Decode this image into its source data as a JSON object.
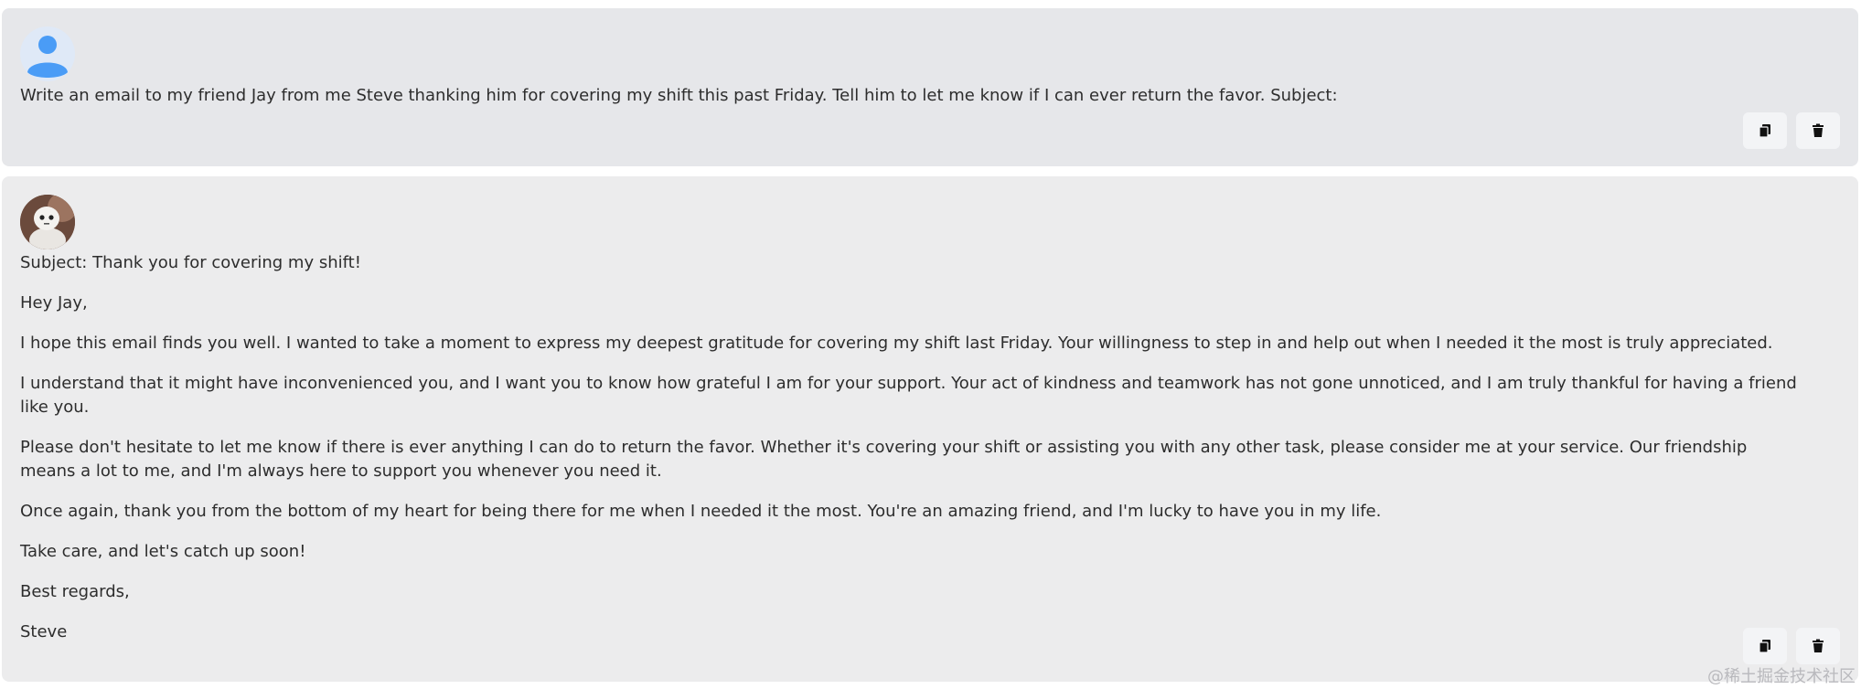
{
  "messages": [
    {
      "role": "user",
      "avatar_icon": "user-icon",
      "paragraphs": [
        "Write an email to my friend Jay from me Steve thanking him for covering my shift this past Friday. Tell him to let me know if I can ever return the favor. Subject:"
      ]
    },
    {
      "role": "assistant",
      "avatar_icon": "robot-avatar",
      "paragraphs": [
        "Subject: Thank you for covering my shift!",
        "Hey Jay,",
        "I hope this email finds you well. I wanted to take a moment to express my deepest gratitude for covering my shift last Friday. Your willingness to step in and help out when I needed it the most is truly appreciated.",
        "I understand that it might have inconvenienced you, and I want you to know how grateful I am for your support. Your act of kindness and teamwork has not gone unnoticed, and I am truly thankful for having a friend like you.",
        "Please don't hesitate to let me know if there is ever anything I can do to return the favor. Whether it's covering your shift or assisting you with any other task, please consider me at your service. Our friendship means a lot to me, and I'm always here to support you whenever you need it.",
        "Once again, thank you from the bottom of my heart for being there for me when I needed it the most. You're an amazing friend, and I'm lucky to have you in my life.",
        "Take care, and let's catch up soon!",
        "Best regards,",
        "Steve"
      ]
    }
  ],
  "actions": {
    "copy_icon": "copy-icon",
    "delete_icon": "trash-icon"
  },
  "watermark": "@稀土掘金技术社区",
  "colors": {
    "user_card_bg": "#e6e7ea",
    "assistant_card_bg": "#ececed",
    "user_icon": "#4a9cf6",
    "button_bg": "#f3f4f6"
  }
}
